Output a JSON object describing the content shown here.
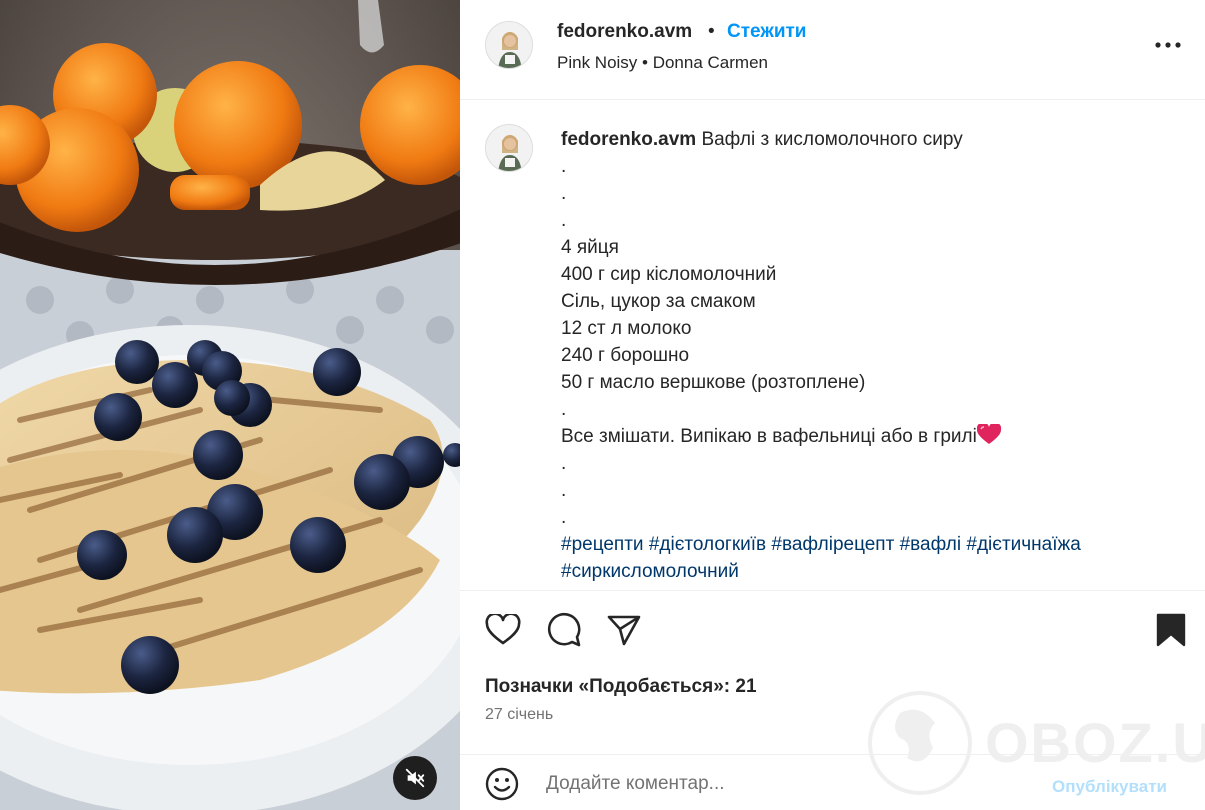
{
  "post": {
    "username": "fedorenko.avm",
    "dot": "•",
    "follow_label": "Стежити",
    "audio": "Pink Noisy • Donna Carmen"
  },
  "caption": {
    "username": "fedorenko.avm",
    "title": "Вафлі з кисломолочного сиру",
    "lines": [
      ".",
      ".",
      ".",
      "4 яйця",
      "400 г сир кісломолочний",
      "Сіль, цукор за смаком",
      "12 ст л молоко",
      "240 г борошно",
      "50 г масло вершкове (розтоплене)",
      ".",
      "Все змішати. Випікаю в вафельниці або в грилі",
      ".",
      ".",
      "."
    ],
    "hashtags_line1": "#рецепти #дієтологкиїв #вафлірецепт #вафлі #дієтичнаїжа",
    "hashtags_line2": "#сиркисломолочний"
  },
  "actions": {
    "like_icon": "heart-outline-icon",
    "comment_icon": "speech-bubble-icon",
    "share_icon": "paper-plane-icon",
    "save_icon": "bookmark-filled-icon"
  },
  "stats": {
    "likes_text": "Позначки «Подобається»: 21",
    "date_text": "27 січень"
  },
  "comment": {
    "placeholder": "Додайте коментар...",
    "publish_label": "Опублікувати"
  },
  "watermark": {
    "text": "OBOZ.UA"
  },
  "colors": {
    "accent": "#0095f6",
    "hashtag": "#00376b",
    "publish_disabled": "#b2dffc",
    "muted": "#737373",
    "heart": "#e0245e"
  }
}
